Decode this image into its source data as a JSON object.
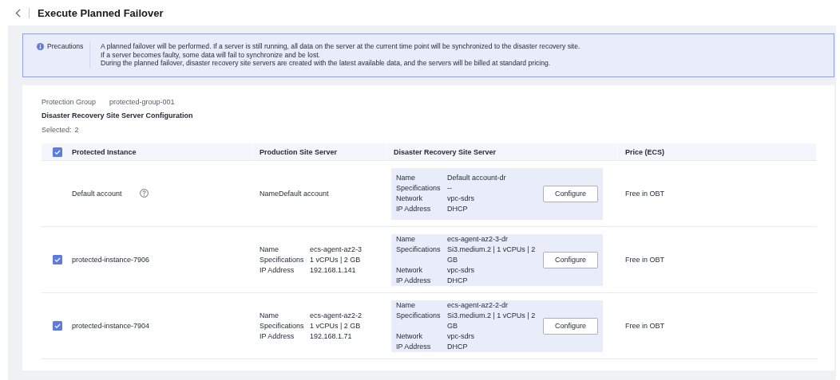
{
  "header": {
    "title": "Execute Planned Failover"
  },
  "notice": {
    "label": "Precautions",
    "lines": [
      "A planned failover will be performed. If a server is still running, all data on the server at the current time point will be synchronized to the disaster recovery site.",
      "If a server becomes faulty, some data will fail to synchronize and be lost.",
      "During the planned failover, disaster recovery site servers are created with the latest available data, and the servers will be billed at standard pricing."
    ]
  },
  "protection_group": {
    "label": "Protection Group",
    "value": "protected-group-001"
  },
  "section_title": "Disaster Recovery Site Server Configuration",
  "selected": {
    "label": "Selected:",
    "value": "2"
  },
  "table": {
    "select_all_checked": true,
    "columns": [
      "Protected Instance",
      "Production Site Server",
      "Disaster Recovery Site Server",
      "Price (ECS)"
    ],
    "rows": [
      {
        "kind": "default",
        "instance": "Default account",
        "production": {
          "text": "NameDefault account"
        },
        "dr": [
          {
            "label": "Name",
            "value": "Default account-dr"
          },
          {
            "label": "Specifications",
            "value": "--"
          },
          {
            "label": "Network",
            "value": "vpc-sdrs"
          },
          {
            "label": "IP Address",
            "value": "DHCP"
          }
        ],
        "button": "Configure",
        "price": "Free in OBT"
      },
      {
        "kind": "instance",
        "checked": true,
        "instance": "protected-instance-7906",
        "production": {
          "details": [
            {
              "label": "Name",
              "value": "ecs-agent-az2-3"
            },
            {
              "label": "Specifications",
              "value": "1 vCPUs | 2 GB"
            },
            {
              "label": "IP Address",
              "value": "192.168.1.141"
            }
          ]
        },
        "dr": [
          {
            "label": "Name",
            "value": "ecs-agent-az2-3-dr"
          },
          {
            "label": "Specifications",
            "value": "Si3.medium.2 | 1 vCPUs | 2 GB"
          },
          {
            "label": "Network",
            "value": "vpc-sdrs"
          },
          {
            "label": "IP Address",
            "value": "DHCP"
          }
        ],
        "button": "Configure",
        "price": "Free in OBT"
      },
      {
        "kind": "instance",
        "checked": true,
        "instance": "protected-instance-7904",
        "production": {
          "details": [
            {
              "label": "Name",
              "value": "ecs-agent-az2-2"
            },
            {
              "label": "Specifications",
              "value": "1 vCPUs | 2 GB"
            },
            {
              "label": "IP Address",
              "value": "192.168.1.71"
            }
          ]
        },
        "dr": [
          {
            "label": "Name",
            "value": "ecs-agent-az2-2-dr"
          },
          {
            "label": "Specifications",
            "value": "Si3.medium.2 | 1 vCPUs | 2 GB"
          },
          {
            "label": "Network",
            "value": "vpc-sdrs"
          },
          {
            "label": "IP Address",
            "value": "DHCP"
          }
        ],
        "button": "Configure",
        "price": "Free in OBT"
      }
    ]
  }
}
